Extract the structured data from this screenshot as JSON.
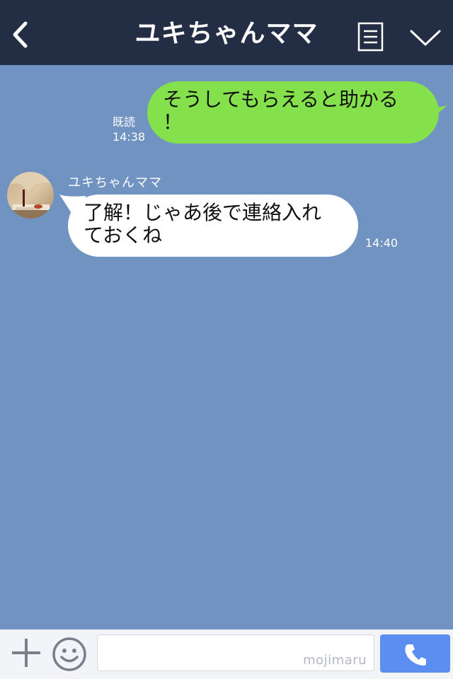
{
  "header": {
    "title": "ユキちゃんママ",
    "back_icon": "chevron-left-icon",
    "menu_icon": "menu-icon",
    "collapse_icon": "chevron-down-icon"
  },
  "messages": {
    "outgoing": {
      "text_line1": "そうしてもらえると助かる",
      "text_line2": "！",
      "read_label": "既読",
      "time": "14:38",
      "bubble_color": "#84e14c"
    },
    "incoming": {
      "sender": "ユキちゃんママ",
      "text_line1": "了解！じゃあ後で連絡入れ",
      "text_line2": "ておくね",
      "time": "14:40",
      "bubble_color": "#ffffff"
    }
  },
  "bottom_bar": {
    "plus_icon": "plus-icon",
    "emoji_icon": "smiley-icon",
    "input_value": "",
    "watermark": "mojimaru",
    "call_icon": "phone-icon",
    "call_color": "#5b8ef0"
  },
  "colors": {
    "header_bg": "#232d43",
    "chat_bg": "#7093c1"
  }
}
